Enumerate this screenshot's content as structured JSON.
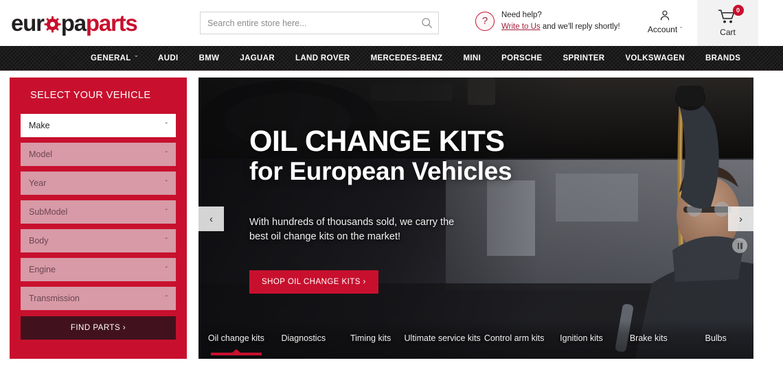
{
  "header": {
    "logo": {
      "part1": "eur",
      "gear": "o",
      "part2": "pa",
      "part3": "parts",
      "alt": "europaparts"
    },
    "search": {
      "placeholder": "Search entire store here...",
      "value": "",
      "icon": "search-icon"
    },
    "help": {
      "icon": "question-mark-icon",
      "line1": "Need help?",
      "link": "Write to Us",
      "line2_rest": " and we'll reply shortly!"
    },
    "account": {
      "label": "Account",
      "icon": "user-icon",
      "caret": "ˇ"
    },
    "cart": {
      "label": "Cart",
      "count": "0",
      "icon": "shopping-cart-icon"
    }
  },
  "nav": {
    "items": [
      {
        "label": "GENERAL",
        "has_caret": true
      },
      {
        "label": "AUDI",
        "has_caret": false
      },
      {
        "label": "BMW",
        "has_caret": false
      },
      {
        "label": "JAGUAR",
        "has_caret": false
      },
      {
        "label": "LAND ROVER",
        "has_caret": false
      },
      {
        "label": "MERCEDES-BENZ",
        "has_caret": false
      },
      {
        "label": "MINI",
        "has_caret": false
      },
      {
        "label": "PORSCHE",
        "has_caret": false
      },
      {
        "label": "SPRINTER",
        "has_caret": false
      },
      {
        "label": "VOLKSWAGEN",
        "has_caret": false
      },
      {
        "label": "BRANDS",
        "has_caret": false
      }
    ]
  },
  "vehicle_selector": {
    "title": "SELECT YOUR VEHICLE",
    "accent_color": "#c8102e",
    "fields": [
      {
        "label": "Make",
        "enabled": true
      },
      {
        "label": "Model",
        "enabled": false
      },
      {
        "label": "Year",
        "enabled": false
      },
      {
        "label": "SubModel",
        "enabled": false
      },
      {
        "label": "Body",
        "enabled": false
      },
      {
        "label": "Engine",
        "enabled": false
      },
      {
        "label": "Transmission",
        "enabled": false
      }
    ],
    "submit_label": "FIND PARTS ›"
  },
  "hero": {
    "headline": "OIL CHANGE KITS",
    "subheadline": "for European Vehicles",
    "description": "With hundreds of thousands sold, we carry the best oil change kits on the market!",
    "cta_label": "SHOP OIL CHANGE KITS ›",
    "prev_arrow": "‹",
    "next_arrow": "›",
    "cta_color": "#c8102e",
    "tabs": [
      {
        "label": "Oil change kits",
        "active": true
      },
      {
        "label": "Diagnostics",
        "active": false
      },
      {
        "label": "Timing kits",
        "active": false
      },
      {
        "label": "Ultimate service kits",
        "active": false
      },
      {
        "label": "Control arm kits",
        "active": false
      },
      {
        "label": "Ignition kits",
        "active": false
      },
      {
        "label": "Brake kits",
        "active": false
      },
      {
        "label": "Bulbs",
        "active": false
      }
    ]
  }
}
